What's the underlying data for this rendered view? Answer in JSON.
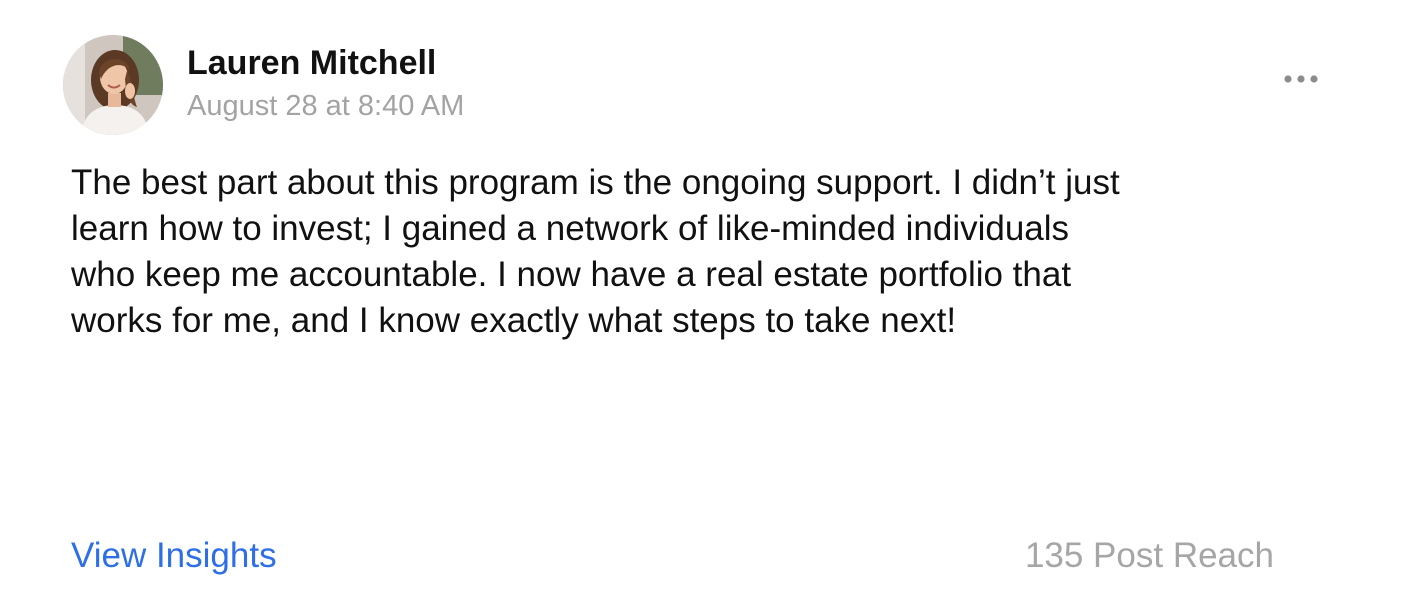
{
  "post": {
    "author": {
      "name": "Lauren Mitchell",
      "avatar_icon": "profile-photo"
    },
    "timestamp": "August 28 at 8:40 AM",
    "more_icon": "more-horizontal-icon",
    "body": "The best part about this program is the ongoing support. I didn’t just\nlearn how to invest; I gained a network of like-minded individuals\nwho keep me accountable. I now have a real estate portfolio that\nworks for me, and I know exactly what steps to take next!",
    "footer": {
      "insights_label": "View Insights",
      "reach_text": "135 Post Reach"
    }
  },
  "colors": {
    "link": "#2f6fe6",
    "muted": "#a3a3a3",
    "text": "#111111"
  }
}
